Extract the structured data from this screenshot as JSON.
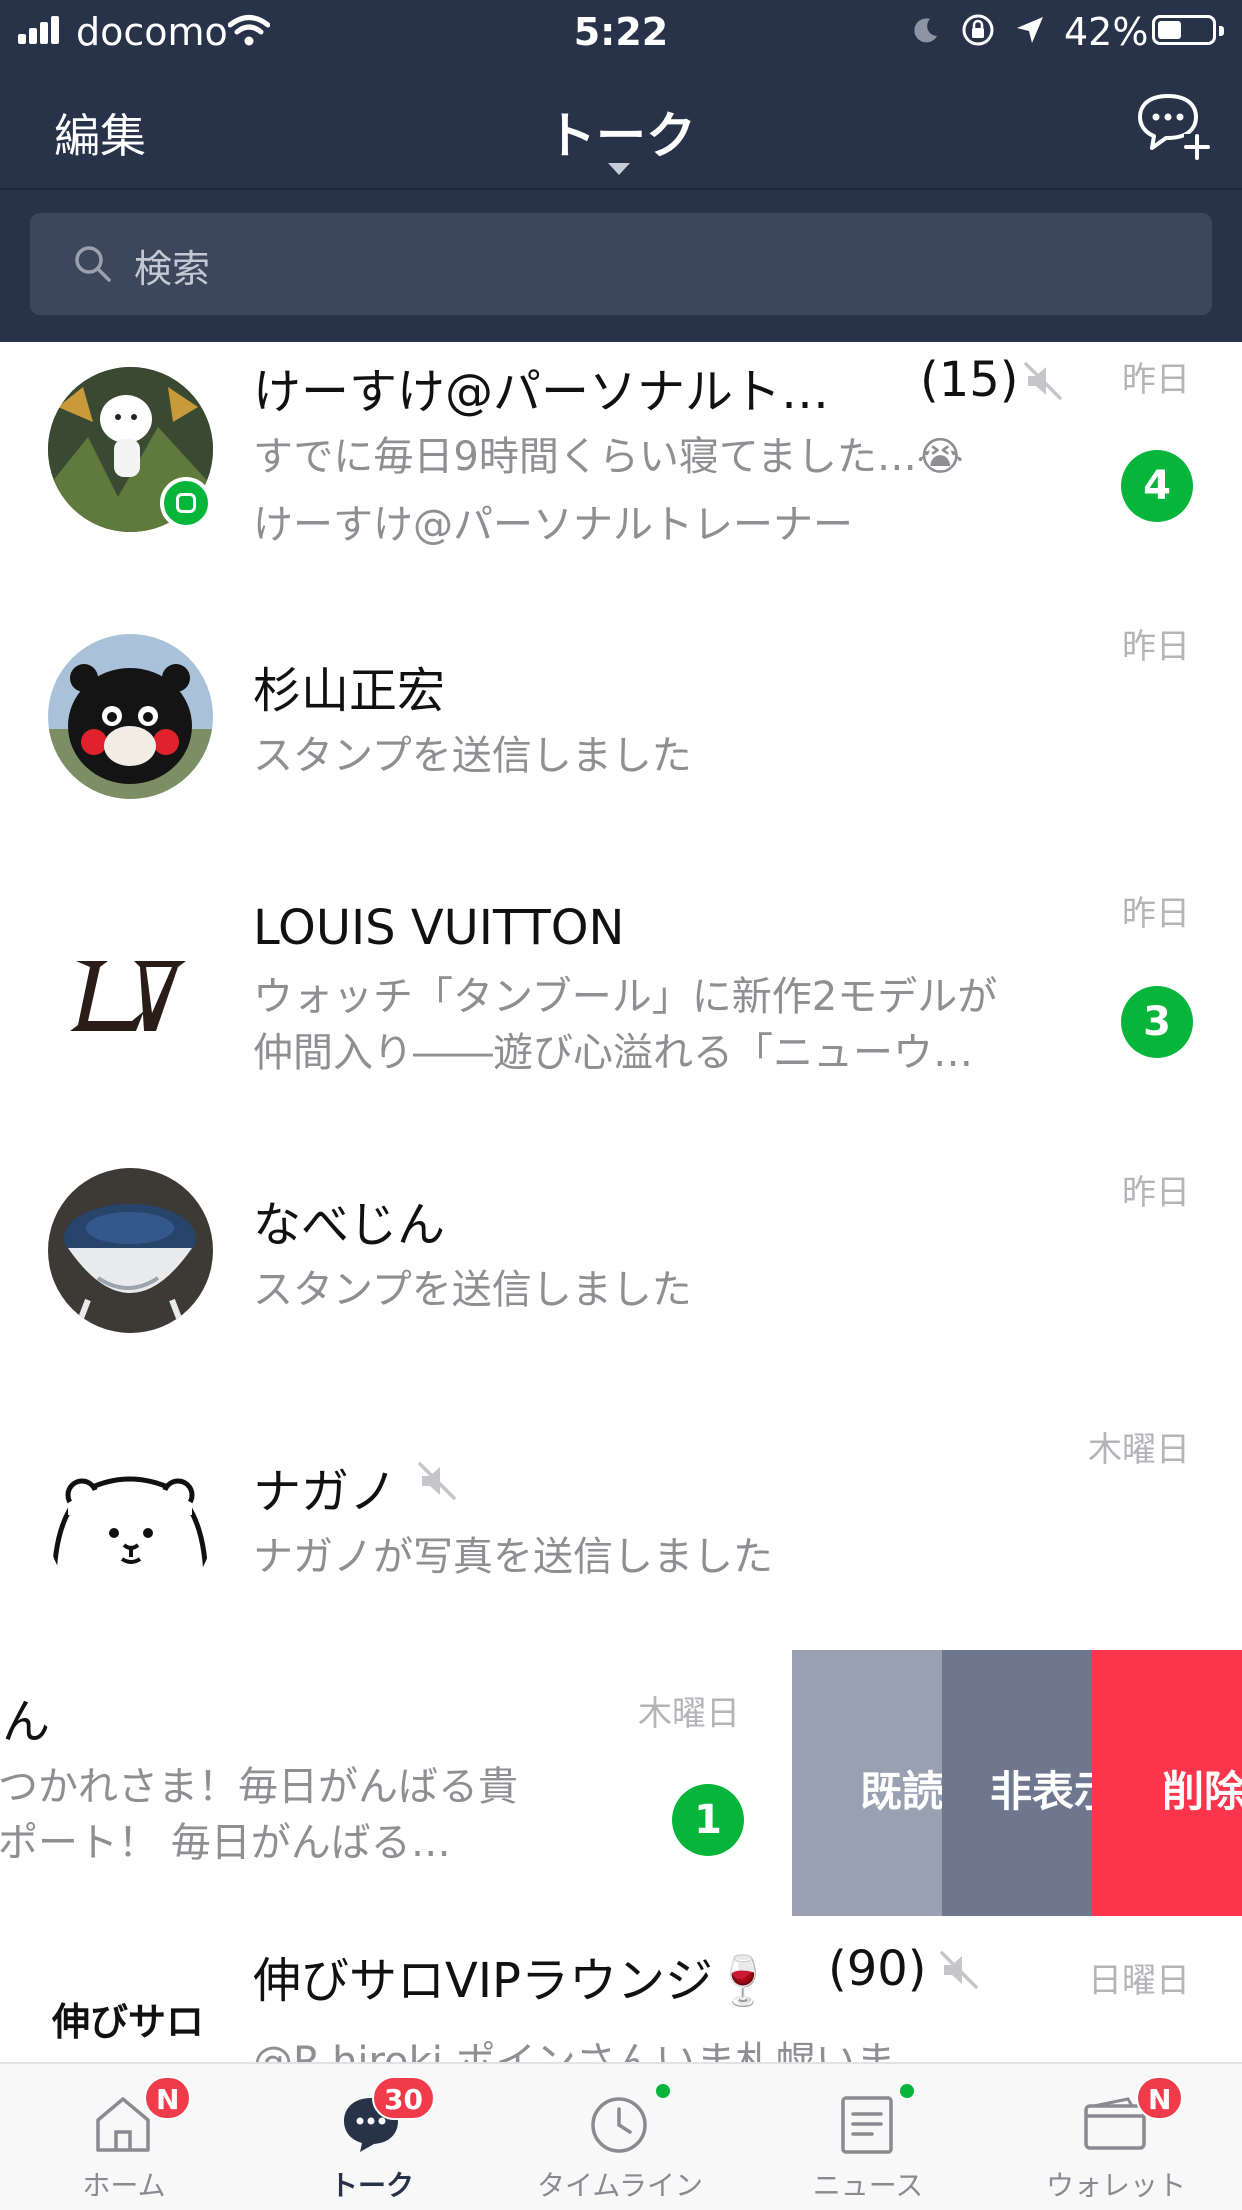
{
  "status_bar": {
    "carrier": "docomo",
    "time": "5:22",
    "battery": "42%"
  },
  "header": {
    "edit": "編集",
    "title": "トーク",
    "new_chat_icon": "chat-add-icon"
  },
  "search": {
    "placeholder": "検索"
  },
  "chats": [
    {
      "name": "けーすけ@パーソナルト…",
      "count": "(15)",
      "muted": true,
      "message": "すでに毎日9時間くらい寝てました…😭",
      "message2": "けーすけ@パーソナルトレーナー",
      "time": "昨日",
      "unread": "4"
    },
    {
      "name": "杉山正宏",
      "message": "スタンプを送信しました",
      "time": "昨日"
    },
    {
      "name": "LOUIS VUITTON",
      "message": "ウォッチ「タンブール」に新作2モデルが",
      "message2": "仲間入り――遊び心溢れる「ニューウ…",
      "time": "昨日",
      "unread": "3"
    },
    {
      "name": "なべじん",
      "message": "スタンプを送信しました",
      "time": "昨日"
    },
    {
      "name": "ナガノ",
      "muted": true,
      "message": "ナガノが写真を送信しました",
      "time": "木曜日"
    },
    {
      "name": "けん",
      "message": "おつかれさま！毎日がんばる貴",
      "message2": "サポート！ 毎日がんばる…",
      "time": "木曜日",
      "unread": "1"
    },
    {
      "name": "伸びサロVIPラウンジ🍷",
      "count": "(90)",
      "muted": true,
      "message": "@R.hiroki ポインさんいま札幌いま",
      "time": "日曜日",
      "avatar_text": "伸びサロ"
    }
  ],
  "swipe_actions": [
    {
      "label": "既読",
      "color": "#98a0b1"
    },
    {
      "label": "非表示",
      "color": "#6e778e"
    },
    {
      "label": "削除",
      "color": "#fd354c"
    }
  ],
  "tabs": [
    {
      "label": "ホーム",
      "badge": "N",
      "icon": "home-icon"
    },
    {
      "label": "トーク",
      "badge": "30",
      "icon": "talk-icon",
      "active": true
    },
    {
      "label": "タイムライン",
      "dot": true,
      "icon": "clock-icon"
    },
    {
      "label": "ニュース",
      "dot": true,
      "icon": "news-icon"
    },
    {
      "label": "ウォレット",
      "badge": "N",
      "icon": "wallet-icon"
    }
  ],
  "colors": {
    "header_bg": "#28334a",
    "badge_green": "#07b53b",
    "tab_badge_red": "#f03c4a",
    "active_tab": "#28334a"
  }
}
